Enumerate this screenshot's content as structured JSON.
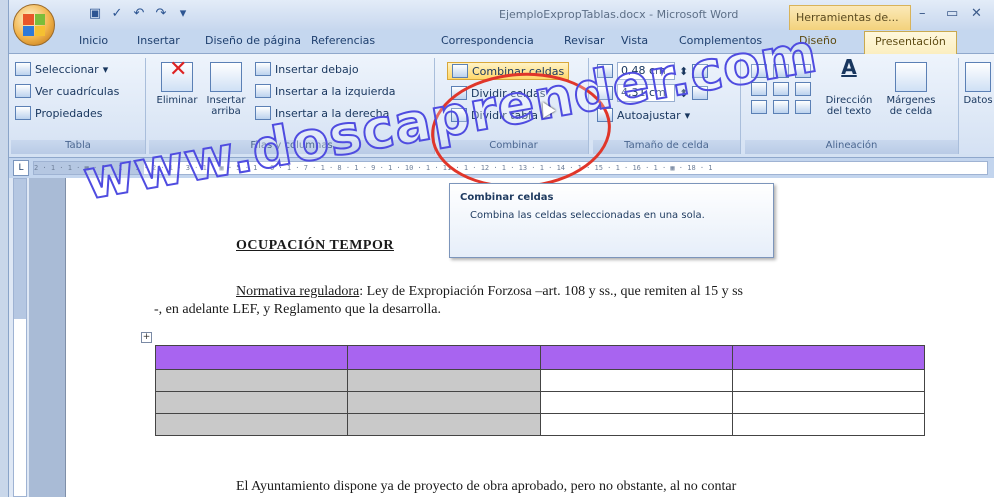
{
  "window": {
    "title": "EjemploExpropTablas.docx - Microsoft Word",
    "context_tab": "Herramientas de...",
    "minimize": "–",
    "maximize": "▭",
    "close": "✕"
  },
  "tabs": [
    {
      "label": "Inicio"
    },
    {
      "label": "Insertar"
    },
    {
      "label": "Diseño de página"
    },
    {
      "label": "Referencias"
    },
    {
      "label": "Correspondencia"
    },
    {
      "label": "Revisar"
    },
    {
      "label": "Vista"
    },
    {
      "label": "Complementos"
    },
    {
      "label": "Diseño"
    },
    {
      "label": "Presentación"
    }
  ],
  "ribbon": {
    "tabla": {
      "label": "Tabla",
      "seleccionar": "Seleccionar",
      "ver_cuadriculas": "Ver cuadrículas",
      "propiedades": "Propiedades"
    },
    "filas_columnas": {
      "label": "Filas y columnas",
      "eliminar": "Eliminar",
      "insertar_arriba": "Insertar arriba",
      "insertar_debajo": "Insertar debajo",
      "insertar_izquierda": "Insertar a la izquierda",
      "insertar_derecha": "Insertar a la derecha"
    },
    "combinar": {
      "label": "Combinar",
      "combinar_celdas": "Combinar celdas",
      "dividir_celdas": "Dividir celdas",
      "dividir_tabla": "Dividir tabla"
    },
    "tamano": {
      "label": "Tamaño de celda",
      "alto": "0,48 cm",
      "ancho": "4,31 cm",
      "autoajustar": "Autoajustar"
    },
    "alineacion": {
      "label": "Alineación",
      "direccion": "Dirección del texto",
      "margenes": "Márgenes de celda"
    },
    "datos": {
      "label": "Datos"
    }
  },
  "tooltip": {
    "title": "Combinar celdas",
    "body": "Combina las celdas seleccionadas en una sola."
  },
  "document": {
    "heading": "OCUPACIÓN TEMPOR",
    "normativa_label": "Normativa reguladora",
    "normativa_text": ": Ley de Expropiación Forzosa –art. 108 y ss., que remiten al 15 y ss",
    "normativa_text2": "-, en adelante LEF, y Reglamento que la desarrolla.",
    "bottom_text": "El Ayuntamiento dispone ya de proyecto de obra aprobado, pero no obstante, al no contar"
  },
  "table": {
    "header_color": "#a864f0",
    "gray_color": "#c9c9c9",
    "rows": 4,
    "cols": 4
  },
  "ruler": {
    "marks": "2 · 1 · 1 · ▦ · 1 · 1 · 1 · 2 · 1 · 3 · 1 · ▦ · 5 · 1 · 6 · 1 · 7 · 1 · 8 · 1 · 9 · 1 · 10 · 1 · 11 · 1 · 12 · 1 · 13 · 1 · 14 · 1 · 15 · 1 · 16 · 1 · ▦ · 18 · 1"
  },
  "watermark": "www.doscaprender.com"
}
